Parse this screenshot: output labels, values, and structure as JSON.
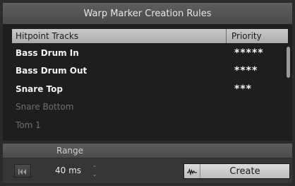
{
  "window": {
    "title": "Warp Marker Creation Rules"
  },
  "table": {
    "columns": {
      "track": "Hitpoint Tracks",
      "priority": "Priority"
    },
    "rows": [
      {
        "name": "Bass Drum In",
        "stars": "*****",
        "enabled": true
      },
      {
        "name": "Bass Drum Out",
        "stars": "****",
        "enabled": true
      },
      {
        "name": "Snare Top",
        "stars": "***",
        "enabled": true
      },
      {
        "name": "Snare Bottom",
        "stars": "",
        "enabled": false
      },
      {
        "name": "Tom 1",
        "stars": "",
        "enabled": false
      }
    ]
  },
  "range": {
    "label": "Range",
    "value": "40 ms",
    "spinner_up": "⌃",
    "spinner_down": "⌄"
  },
  "actions": {
    "create_label": "Create"
  },
  "icons": {
    "skip": "skip-back-icon",
    "waveform": "hitpoint-waveform-icon"
  },
  "colors": {
    "header_bg": "#bdbdbd",
    "list_bg": "#1e1e1e",
    "active_text": "#f4f4f4",
    "inactive_text": "#6e6e6e"
  }
}
